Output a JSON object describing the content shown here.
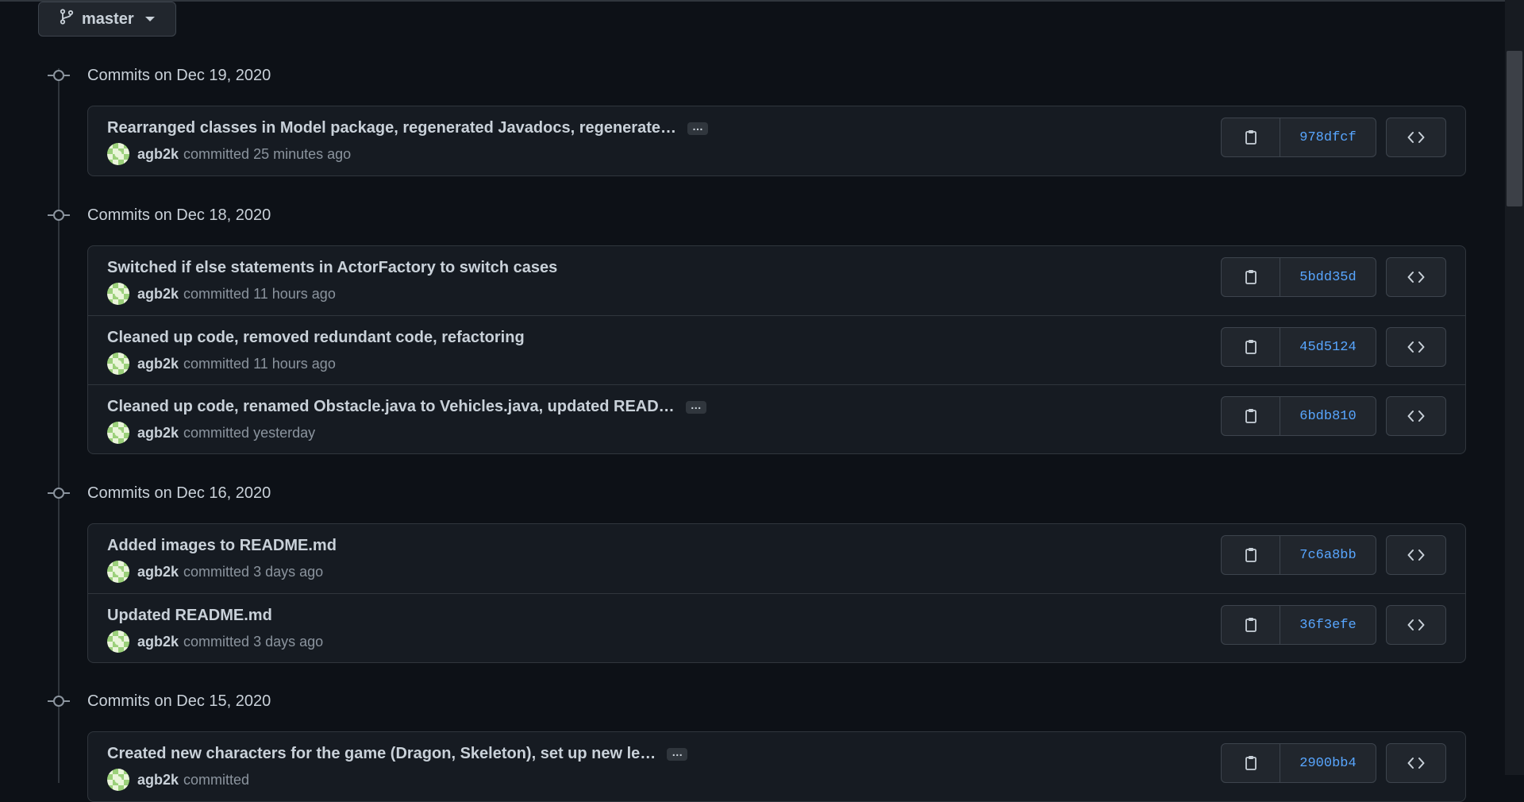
{
  "branch": {
    "label": "master",
    "icon": "git-branch-icon"
  },
  "groups": [
    {
      "title": "Commits on Dec 19, 2020",
      "commits": [
        {
          "message": "Rearranged classes in Model package, regenerated Javadocs, regenerate…",
          "has_more": true,
          "author": "agb2k",
          "verb": "committed",
          "time": "25 minutes ago",
          "sha": "978dfcf"
        }
      ]
    },
    {
      "title": "Commits on Dec 18, 2020",
      "commits": [
        {
          "message": "Switched if else statements in ActorFactory to switch cases",
          "has_more": false,
          "author": "agb2k",
          "verb": "committed",
          "time": "11 hours ago",
          "sha": "5bdd35d"
        },
        {
          "message": "Cleaned up code, removed redundant code, refactoring",
          "has_more": false,
          "author": "agb2k",
          "verb": "committed",
          "time": "11 hours ago",
          "sha": "45d5124"
        },
        {
          "message": "Cleaned up code, renamed Obstacle.java to Vehicles.java, updated READ…",
          "has_more": true,
          "author": "agb2k",
          "verb": "committed",
          "time": "yesterday",
          "sha": "6bdb810"
        }
      ]
    },
    {
      "title": "Commits on Dec 16, 2020",
      "commits": [
        {
          "message": "Added images to README.md",
          "has_more": false,
          "author": "agb2k",
          "verb": "committed",
          "time": "3 days ago",
          "sha": "7c6a8bb"
        },
        {
          "message": "Updated README.md",
          "has_more": false,
          "author": "agb2k",
          "verb": "committed",
          "time": "3 days ago",
          "sha": "36f3efe"
        }
      ]
    },
    {
      "title": "Commits on Dec 15, 2020",
      "commits": [
        {
          "message": "Created new characters for the game (Dragon, Skeleton), set up new le…",
          "has_more": true,
          "author": "agb2k",
          "verb": "committed",
          "time": "",
          "sha": "2900bb4"
        }
      ]
    }
  ],
  "ellipsis_label": "…",
  "icons": {
    "copy": "clipboard-icon",
    "browse": "code-icon",
    "group": "git-commit-icon"
  },
  "colors": {
    "background": "#0d1117",
    "box": "#161b22",
    "border": "#30363d",
    "sha": "#58a6ff",
    "muted": "#8b949e",
    "text": "#c9d1d9"
  }
}
